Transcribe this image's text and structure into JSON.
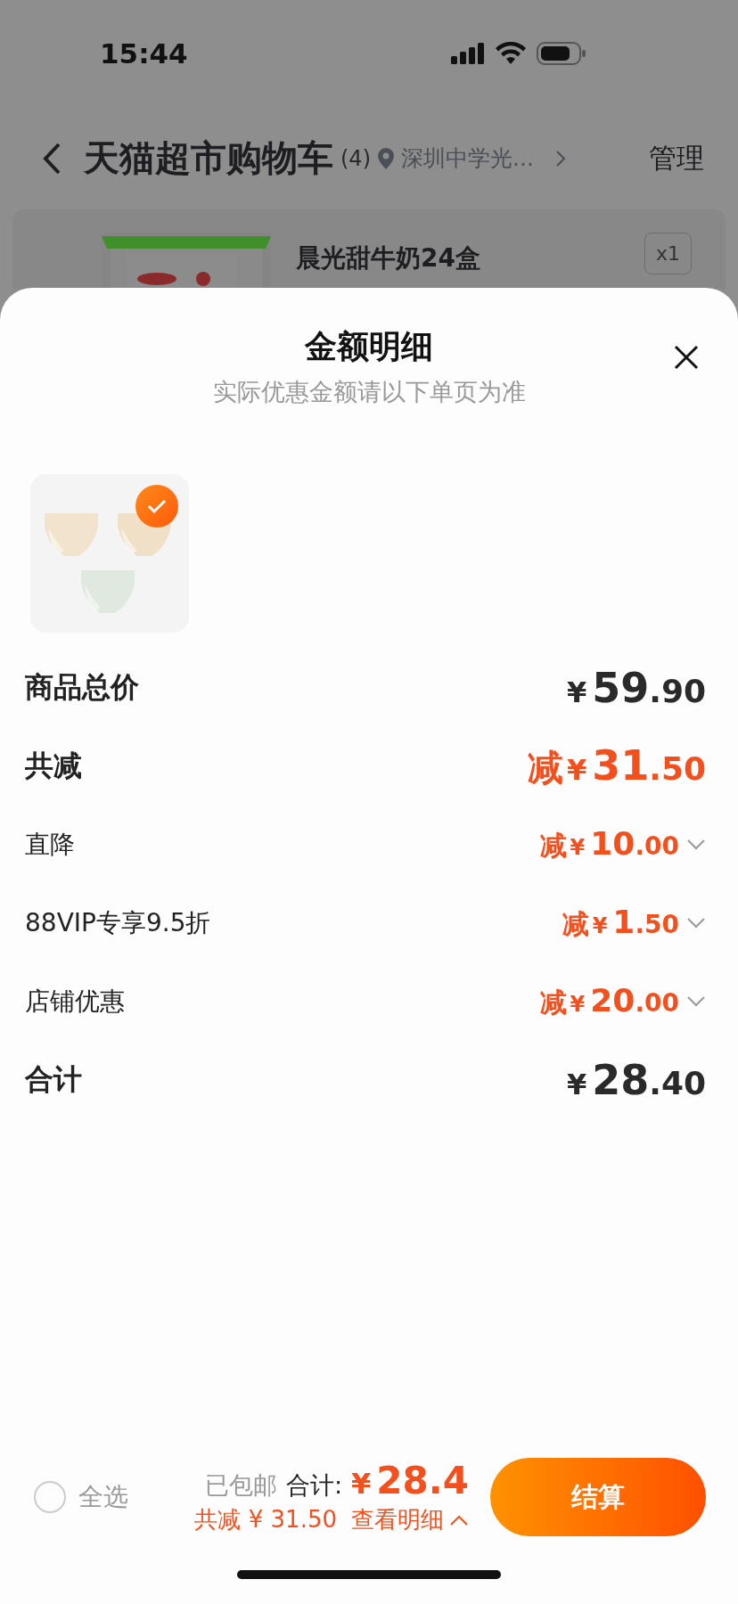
{
  "status_bar": {
    "time": "15:44"
  },
  "header": {
    "title": "天猫超市购物车",
    "count": "(4)",
    "location": "深圳中学光...",
    "action": "管理"
  },
  "background_item": {
    "name": "晨光甜牛奶24盒",
    "quantity": "x1"
  },
  "sheet": {
    "title": "金额明细",
    "subtitle": "实际优惠金额请以下单页为准",
    "products": [
      {
        "kind": "picture",
        "selected": true
      }
    ],
    "rows": [
      {
        "kind": "total",
        "label": "商品总价",
        "prefix": "",
        "currency": "¥",
        "yuan": "59",
        "fen": ".90",
        "expandable": false
      },
      {
        "kind": "discount",
        "label": "共减",
        "prefix": "减",
        "currency": "¥",
        "yuan": "31",
        "fen": ".50",
        "expandable": false
      },
      {
        "kind": "sub",
        "label": "直降",
        "prefix": "减",
        "currency": "¥",
        "yuan": "10",
        "fen": ".00",
        "expandable": true,
        "expanded": false
      },
      {
        "kind": "sub",
        "label": "88VIP专享9.5折",
        "prefix": "减",
        "currency": "¥",
        "yuan": "1",
        "fen": ".50",
        "expandable": true,
        "expanded": false
      },
      {
        "kind": "sub",
        "label": "店铺优惠",
        "prefix": "减",
        "currency": "¥",
        "yuan": "20",
        "fen": ".00",
        "expandable": true,
        "expanded": false
      },
      {
        "kind": "total",
        "label": "合计",
        "prefix": "",
        "currency": "¥",
        "yuan": "28",
        "fen": ".40",
        "expandable": false
      }
    ]
  },
  "footer": {
    "select_all": {
      "label": "全选",
      "checked": false
    },
    "shipping": "已包邮",
    "total_label": "合计:",
    "currency": "¥",
    "total": "28.4",
    "saved": "共减 ¥ 31.50",
    "details_link": "查看明细",
    "details_expanded": true,
    "checkout": "结算"
  }
}
